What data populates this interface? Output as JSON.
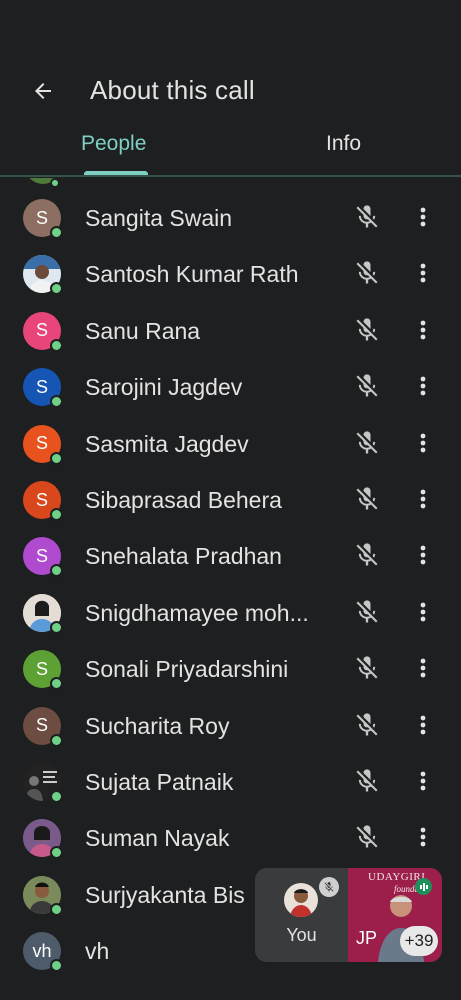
{
  "header": {
    "title": "About this call",
    "back_icon": "arrow-back-icon"
  },
  "tabs": [
    {
      "label": "People",
      "active": true
    },
    {
      "label": "Info",
      "active": false
    }
  ],
  "colors": {
    "background": "#1e1f20",
    "accent": "#7fcfc4",
    "presence": "#6fd187"
  },
  "participants": [
    {
      "name": "Sangita Swain",
      "initial": "S",
      "avatar_color": "#8d6e63",
      "photo": false,
      "mic": "mic-off-icon"
    },
    {
      "name": "Santosh Kumar Rath",
      "initial": "",
      "avatar_color": "#2f5f8f",
      "photo": true,
      "mic": "mic-off-icon"
    },
    {
      "name": "Sanu Rana",
      "initial": "S",
      "avatar_color": "#e8457a",
      "photo": false,
      "mic": "mic-off-icon"
    },
    {
      "name": "Sarojini Jagdev",
      "initial": "S",
      "avatar_color": "#1556b5",
      "photo": false,
      "mic": "mic-off-icon"
    },
    {
      "name": "Sasmita Jagdev",
      "initial": "S",
      "avatar_color": "#e8521f",
      "photo": false,
      "mic": "mic-off-icon"
    },
    {
      "name": "Sibaprasad Behera",
      "initial": "S",
      "avatar_color": "#d9481c",
      "photo": false,
      "mic": "mic-off-icon"
    },
    {
      "name": "Snehalata Pradhan",
      "initial": "S",
      "avatar_color": "#b04bd0",
      "photo": false,
      "mic": "mic-off-icon"
    },
    {
      "name": "Snigdhamayee moh...",
      "initial": "",
      "avatar_color": "#d8c8b8",
      "photo": true,
      "mic": "mic-off-icon"
    },
    {
      "name": "Sonali Priyadarshini",
      "initial": "S",
      "avatar_color": "#5da135",
      "photo": false,
      "mic": "mic-off-icon"
    },
    {
      "name": "Sucharita Roy",
      "initial": "S",
      "avatar_color": "#6d4c41",
      "photo": false,
      "mic": "mic-off-icon"
    },
    {
      "name": "Sujata Patnaik",
      "initial": "",
      "avatar_color": "#2b2b2b",
      "photo": true,
      "mic": "mic-off-icon"
    },
    {
      "name": "Suman Nayak",
      "initial": "",
      "avatar_color": "#6a4a7a",
      "photo": true,
      "mic": "mic-off-icon"
    },
    {
      "name": "Surjyakanta Bis",
      "initial": "",
      "avatar_color": "#4a6b3a",
      "photo": true,
      "mic": ""
    },
    {
      "name": "vh",
      "initial": "vh",
      "avatar_color": "#4d5b6a",
      "photo": false,
      "mic": ""
    }
  ],
  "pip": {
    "self_label": "You",
    "other_initials": "JP",
    "other_count": "+39",
    "brand_line1": "UDAYGIRI",
    "brand_line2": "foundati"
  }
}
